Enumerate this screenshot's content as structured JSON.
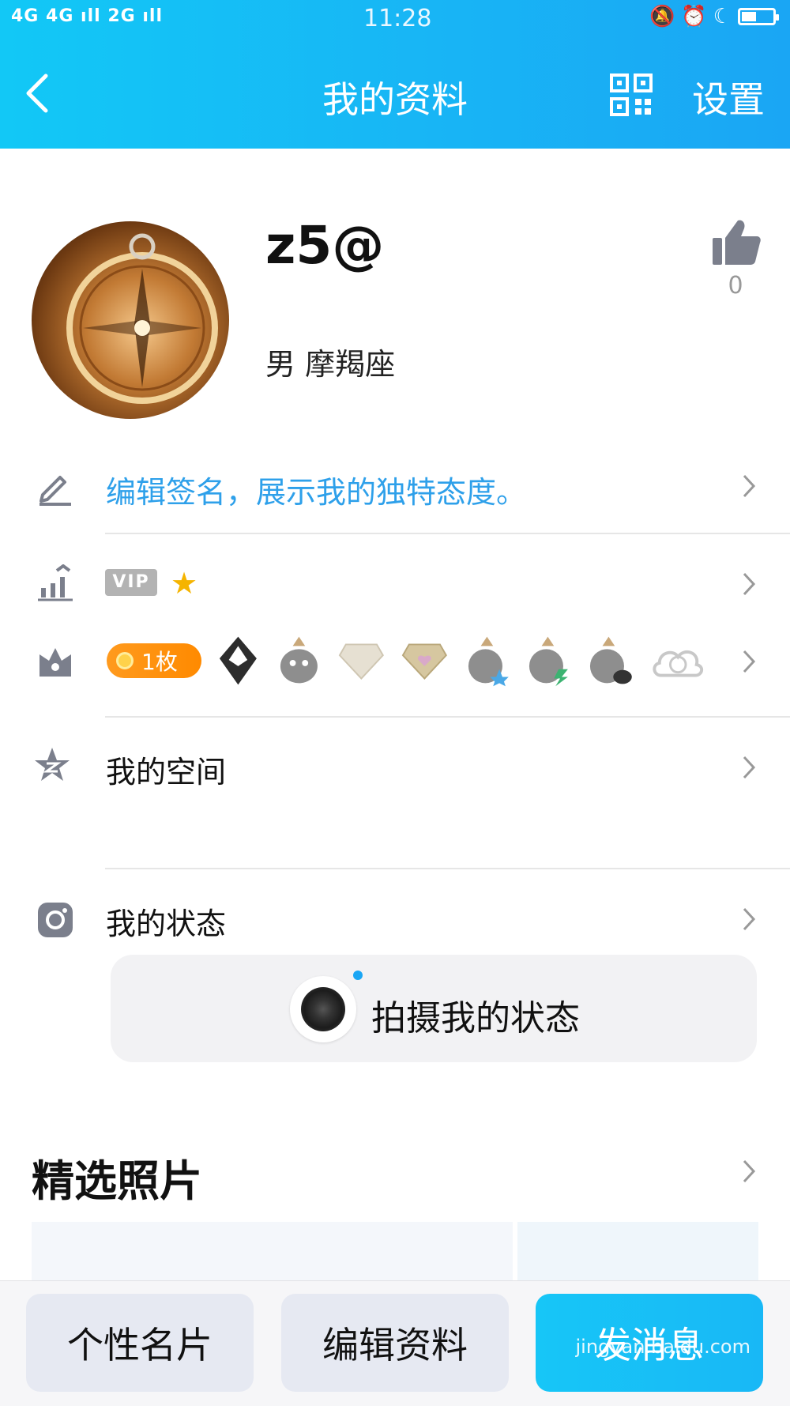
{
  "status_bar": {
    "network": "4G 4G ıll 2G ıll",
    "time": "11:28"
  },
  "header": {
    "title": "我的资料",
    "settings_label": "设置",
    "background_color": "#18b5f5"
  },
  "profile": {
    "nickname": "z5@",
    "meta": "男  摩羯座",
    "like_count": "0"
  },
  "rows": {
    "signature": "编辑签名，展示我的独特态度。",
    "vip_badge": "VIP",
    "medal_count": "1枚",
    "space_label": "我的空间",
    "status_label": "我的状态"
  },
  "status_card": {
    "capture_label": "拍摄我的状态"
  },
  "photos": {
    "section_title": "精选照片"
  },
  "bottom_bar": {
    "card_label": "个性名片",
    "edit_label": "编辑资料",
    "message_label": "发消息"
  },
  "watermark": "jingyan.baidu.com",
  "colors": {
    "accent": "#1aa6f4",
    "link": "#2ea0ea",
    "medal": "#ff9000"
  }
}
